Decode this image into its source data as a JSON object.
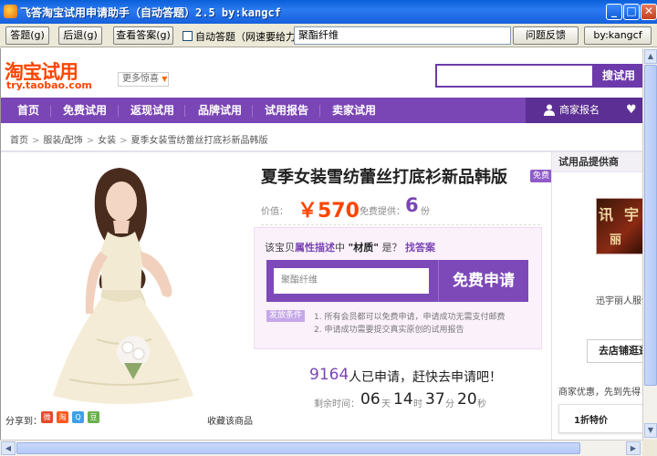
{
  "window": {
    "title": "飞答淘宝试用申请助手（自动答题）2.5 by:kangcf",
    "min_label": "_",
    "max_label": "□",
    "close_label": "✕"
  },
  "toolbar": {
    "answer_button": "答题(g)",
    "back_button": "后退(g)",
    "view_answer_button": "查看答案(g)",
    "auto_answer_label": "自动答题（网速要给力啊）",
    "answer_value": "聚酯纤维",
    "feedback_button": "问题反馈",
    "author_button": "by:kangcf"
  },
  "site": {
    "logo_main": "淘宝试用",
    "logo_sub": "try.taobao.com",
    "more_label": "更多惊喜",
    "search_placeholder": "",
    "search_button": "搜试用"
  },
  "nav": {
    "items": [
      "首页",
      "免费试用",
      "返现试用",
      "品牌试用",
      "试用报告",
      "卖家试用"
    ],
    "merchant_label": "商家报名"
  },
  "breadcrumb": [
    "首页",
    "服装/配饰",
    "女装",
    "夏季女装雪纺蕾丝打底衫新品韩版"
  ],
  "product": {
    "title": "夏季女装雪纺蕾丝打底衫新品韩版",
    "free_tag": "免费",
    "price_label": "价值：",
    "price_value": "￥570",
    "supply_label": "免费提供：",
    "supply_value": "6",
    "supply_unit": "份",
    "question_prefix": "该宝贝",
    "question_highlight": "属性描述",
    "question_mid": "中",
    "question_key": "\"材质\"",
    "question_suffix": "是？",
    "question_link": "找答案",
    "answer_value": "聚酯纤维",
    "apply_button": "免费申请",
    "condition_tag": "发放条件",
    "condition_1": "1. 所有会员都可以免费申请，申请成功无需支付邮费",
    "condition_2": "2. 申请成功需要提交真实原创的试用报告",
    "applied_count": "9164",
    "applied_text": "人已申请，赶快去申请吧！",
    "remain_label": "剩余时间：",
    "countdown": {
      "days": "06",
      "days_unit": "天",
      "hours": "14",
      "hours_unit": "时",
      "minutes": "37",
      "minutes_unit": "分",
      "seconds": "20",
      "seconds_unit": "秒"
    },
    "share_label": "分享到：",
    "favorite_label": "收藏该商品"
  },
  "supplier": {
    "header": "试用品提供商",
    "logo_text_1": "讯",
    "logo_text_2": "宇",
    "logo_text_3": "丽",
    "name": "迅宇丽人服饰",
    "visit_button": "去店铺逛逛",
    "promo_label": "商家优惠，先到先得：",
    "promo_card": "1折特价"
  },
  "colors": {
    "purple": "#7a45b5",
    "orange": "#ff4400",
    "xp_blue": "#0a5fd8"
  }
}
